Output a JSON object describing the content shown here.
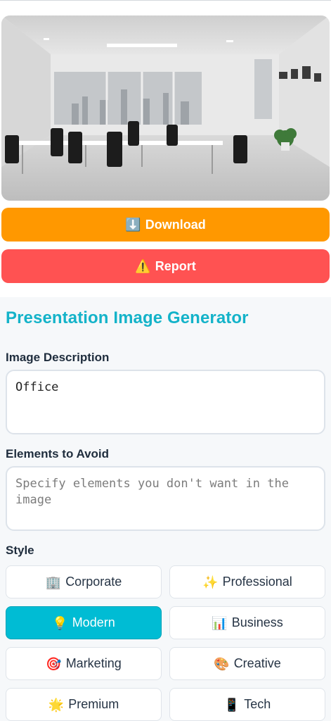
{
  "actions": {
    "download_icon": "⬇️",
    "download_label": "Download",
    "report_icon": "⚠️",
    "report_label": "Report"
  },
  "form": {
    "title": "Presentation Image Generator",
    "description_label": "Image Description",
    "description_value": "Office",
    "avoid_label": "Elements to Avoid",
    "avoid_placeholder": "Specify elements you don't want in the image",
    "style_label": "Style"
  },
  "styles": [
    {
      "icon": "🏢",
      "label": "Corporate",
      "selected": false
    },
    {
      "icon": "✨",
      "label": "Professional",
      "selected": false
    },
    {
      "icon": "💡",
      "label": "Modern",
      "selected": true
    },
    {
      "icon": "📊",
      "label": "Business",
      "selected": false
    },
    {
      "icon": "🎯",
      "label": "Marketing",
      "selected": false
    },
    {
      "icon": "🎨",
      "label": "Creative",
      "selected": false
    },
    {
      "icon": "🌟",
      "label": "Premium",
      "selected": false
    },
    {
      "icon": "📱",
      "label": "Tech",
      "selected": false
    }
  ],
  "colors": {
    "download": "#ff9800",
    "report": "#ff5252",
    "accent": "#00bcd4",
    "title": "#14b3c9"
  }
}
